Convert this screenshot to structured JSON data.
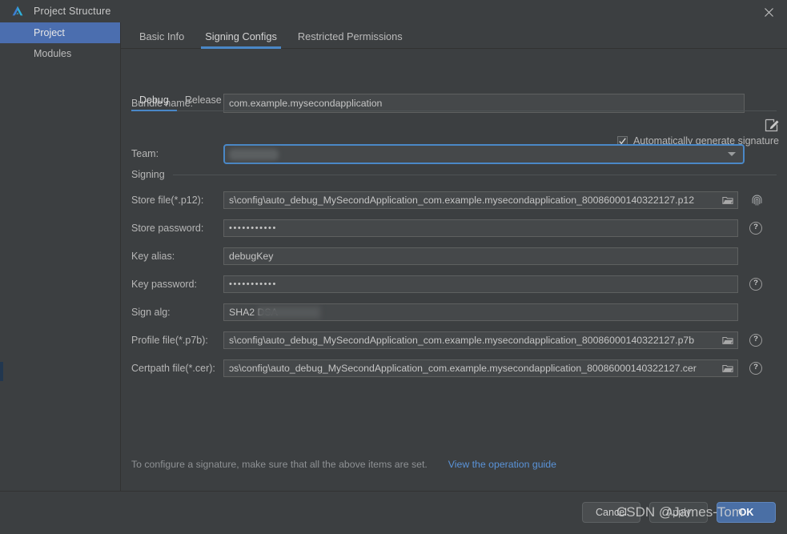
{
  "window": {
    "title": "Project Structure",
    "app_icon": "deveco-triangle-icon",
    "close_icon": "close-icon"
  },
  "sidebar": {
    "items": [
      {
        "label": "Project",
        "selected": true
      },
      {
        "label": "Modules",
        "selected": false
      }
    ]
  },
  "tabs": [
    {
      "label": "Basic Info",
      "active": false
    },
    {
      "label": "Signing Configs",
      "active": true
    },
    {
      "label": "Restricted Permissions",
      "active": false
    }
  ],
  "bundle": {
    "label": "Bundle name:",
    "value": "com.example.mysecondapplication",
    "edit_icon": "edit-pencil-icon"
  },
  "build_tabs": [
    {
      "label": "Debug",
      "active": true
    },
    {
      "label": "Release",
      "active": false
    }
  ],
  "auto_signature": {
    "label": "Automatically generate signature",
    "checked": true,
    "check_glyph": "✓"
  },
  "team": {
    "label": "Team:",
    "value": "",
    "caret_icon": "chevron-down-icon"
  },
  "signing_group_label": "Signing",
  "fields": [
    {
      "label": "Store file(*.p12):",
      "value": "s\\config\\auto_debug_MySecondApplication_com.example.mysecondapplication_80086000140322127.p12",
      "type": "path",
      "browse_icon": "folder-icon",
      "trailing_icon": "fingerprint-icon"
    },
    {
      "label": "Store password:",
      "value": "•••••••••••",
      "type": "password",
      "trailing_icon": "help-icon"
    },
    {
      "label": "Key alias:",
      "value": "debugKey",
      "type": "text",
      "trailing_icon": ""
    },
    {
      "label": "Key password:",
      "value": "•••••••••••",
      "type": "password",
      "trailing_icon": "help-icon"
    },
    {
      "label": "Sign alg:",
      "value": "SHA2                 DSA",
      "type": "text-redacted",
      "trailing_icon": ""
    },
    {
      "label": "Profile file(*.p7b):",
      "value": "s\\config\\auto_debug_MySecondApplication_com.example.mysecondapplication_80086000140322127.p7b",
      "type": "path",
      "browse_icon": "folder-icon",
      "trailing_icon": "help-icon"
    },
    {
      "label": "Certpath file(*.cer):",
      "value": "ɔs\\config\\auto_debug_MySecondApplication_com.example.mysecondapplication_80086000140322127.cer",
      "type": "path",
      "browse_icon": "folder-icon",
      "trailing_icon": "help-icon"
    }
  ],
  "footer": {
    "note": "To configure a signature, make sure that all the above items are set.",
    "link": "View the operation guide"
  },
  "buttons": {
    "cancel": "Cancel",
    "apply": "Apply",
    "ok": "OK"
  },
  "watermark": "CSDN @James-Tom",
  "colors": {
    "background": "#3c3f41",
    "field": "#45484a",
    "accent": "#4a88c7",
    "selection": "#4b6eaf",
    "ok_button": "#4a6fa5",
    "link": "#5a93d8"
  }
}
